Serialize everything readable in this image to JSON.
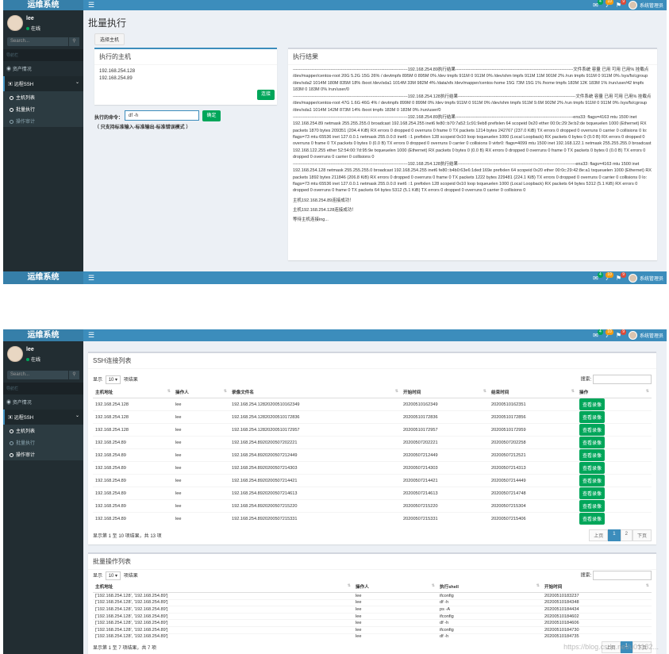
{
  "brand": "运维系统",
  "topbar": {
    "mail_badge": "4",
    "bell_badge": "10",
    "flag_badge": "9",
    "user": "系统管理员"
  },
  "user": {
    "name": "lee",
    "status": "在线"
  },
  "sidebar": {
    "search_placeholder": "Search...",
    "header": "导航栏",
    "asset": "资产情况",
    "ssh": "远程SSH",
    "sub": [
      "主机列表",
      "批量执行",
      "操作审计"
    ]
  },
  "page1": {
    "title": "批量执行",
    "select_btn": "选择主机",
    "hosts_title": "执行的主机",
    "hosts": [
      "192.168.254.128",
      "192.168.254.89"
    ],
    "connect_btn": "连接",
    "cmd_label": "执行的命令：",
    "cmd_value": "df -h",
    "confirm_btn": "确定",
    "hint": "（ 只支持标准输入-标准输出-标准错误模式 ）",
    "result_title": "执行结果",
    "result_blocks": [
      "-------------------------------------------------------------------------------192.168.254.89执行结果---------------------------------------------------------------------------------文件系统 容量 已用 可用 已用% 挂载点 /dev/mapper/centos-root 20G 5.2G 15G 26% / devtmpfs 895M 0 895M 0% /dev tmpfs 911M 0 911M 0% /dev/shm tmpfs 911M 11M 901M 2% /run tmpfs 911M 0 911M 0% /sys/fs/cgroup /dev/sda2 1014M 180M 835M 18% /boot /dev/sda1 1014M 33M 982M 4% /data/xfs /dev/mapper/centos-home 15G 73M 15G 1% /home tmpfs 183M 12K 183M 1% /run/user/42 tmpfs 183M 0 183M 0% /run/user/0",
      "-------------------------------------------------------------------------------192.168.254.128执行结果---------------------------------------------------------------------------------文件系统 容量 已用 可用 已用% 挂载点 /dev/mapper/centos-root 47G 1.6G 46G 4% / devtmpfs 899M 0 899M 0% /dev tmpfs 911M 0 911M 0% /dev/shm tmpfs 911M 9.6M 902M 2% /run tmpfs 911M 0 911M 0% /sys/fs/cgroup /dev/sda1 1014M 142M 873M 14% /boot tmpfs 183M 0 183M 0% /run/user/0",
      "-------------------------------------------------------------------------------192.168.254.89执行结果---------------------------------------------------------------------------------ens33: flags=4163 mtu 1500 inet 192.168.254.89 netmask 255.255.255.0 broadcast 192.168.254.255 inet6 fe80::b70:7a52:1c91:9eb8 prefixlen 64 scopeid 0x20 ether 00:0c:29:3e:b2:de txqueuelen 1000 (Ethernet) RX packets 1870 bytes 209351 (204.4 KiB) RX errors 0 dropped 0 overruns 0 frame 0 TX packets 1214 bytes 242767 (237.0 KiB) TX errors 0 dropped 0 overruns 0 carrier 0 collisions 0 lo: flags=73 mtu 65536 inet 127.0.0.1 netmask 255.0.0.0 inet6 ::1 prefixlen 128 scopeid 0x10 loop txqueuelen 1000 (Local Loopback) RX packets 0 bytes 0 (0.0 B) RX errors 0 dropped 0 overruns 0 frame 0 TX packets 0 bytes 0 (0.0 B) TX errors 0 dropped 0 overruns 0 carrier 0 collisions 0 virbr0: flags=4099 mtu 1500 inet 192.168.122.1 netmask 255.255.255.0 broadcast 192.168.122.255 ether 52:54:00:7d:95:9e txqueuelen 1000 (Ethernet) RX packets 0 bytes 0 (0.0 B) RX errors 0 dropped 0 overruns 0 frame 0 TX packets 0 bytes 0 (0.0 B) TX errors 0 dropped 0 overruns 0 carrier 0 collisions 0",
      "-------------------------------------------------------------------------------192.168.254.128执行结果---------------------------------------------------------------------------------ens33: flags=4163 mtu 1500 inet 192.168.254.128 netmask 255.255.255.0 broadcast 192.168.254.255 inet6 fe80::b4b0:63e6:1ded:169e prefixlen 64 scopeid 0x20 ether 00:0c:29:42:8e:a1 txqueuelen 1000 (Ethernet) RX packets 1892 bytes 211846 (206.8 KiB) RX errors 0 dropped 0 overruns 0 frame 0 TX packets 1222 bytes 229481 (224.1 KiB) TX errors 0 dropped 0 overruns 0 carrier 0 collisions 0 lo: flags=73 mtu 65536 inet 127.0.0.1 netmask 255.0.0.0 inet6 ::1 prefixlen 128 scopeid 0x10 loop txqueuelen 1000 (Local Loopback) RX packets 64 bytes 5312 (5.1 KiB) RX errors 0 dropped 0 overruns 0 frame 0 TX packets 64 bytes 5312 (5.1 KiB) TX errors 0 dropped 0 overruns 0 carrier 0 collisions 0"
    ],
    "result_msgs": [
      "主机192.168.254.89连接成功！",
      "主机192.168.254.128连接成功！",
      "等待主机连接ing..."
    ]
  },
  "ssh_table": {
    "title": "SSH连接列表",
    "show_label": "显示",
    "page_size": "10",
    "suffix_label": "项结果",
    "search_label": "搜索:",
    "columns": [
      "主机地址",
      "操作人",
      "录像文件名",
      "开始时间",
      "结束时间",
      "操作"
    ],
    "rows": [
      [
        "192.168.254.128",
        "lee",
        "192.168.254.12820200510162349",
        "20200510162349",
        "20200510162351"
      ],
      [
        "192.168.254.128",
        "lee",
        "192.168.254.12820200510172836",
        "20200510172836",
        "20200510172856"
      ],
      [
        "192.168.254.128",
        "lee",
        "192.168.254.12820200510172957",
        "20200510172957",
        "20200510172959"
      ],
      [
        "192.168.254.89",
        "lee",
        "192.168.254.8920200507202221",
        "20200507202221",
        "20200507202258"
      ],
      [
        "192.168.254.89",
        "lee",
        "192.168.254.8920200507212449",
        "20200507212449",
        "20200507212521"
      ],
      [
        "192.168.254.89",
        "lee",
        "192.168.254.8920200507214303",
        "20200507214303",
        "20200507214313"
      ],
      [
        "192.168.254.89",
        "lee",
        "192.168.254.8920200507214421",
        "20200507214421",
        "20200507214449"
      ],
      [
        "192.168.254.89",
        "lee",
        "192.168.254.8920200507214613",
        "20200507214613",
        "20200507214748"
      ],
      [
        "192.168.254.89",
        "lee",
        "192.168.254.8920200507215220",
        "20200507215220",
        "20200507215304"
      ],
      [
        "192.168.254.89",
        "lee",
        "192.168.254.8920200507215331",
        "20200507215331",
        "20200507215406"
      ]
    ],
    "action_btn": "查看录像",
    "info": "显示第 1 至 10 项结果，共 13 项",
    "prev": "上页",
    "pages": [
      "1",
      "2"
    ],
    "next": "下页"
  },
  "batch_table": {
    "title": "批量操作列表",
    "show_label": "显示",
    "page_size": "10",
    "suffix_label": "项结果",
    "search_label": "搜索:",
    "columns": [
      "主机地址",
      "操作人",
      "执行shell",
      "开始时间"
    ],
    "rows": [
      [
        "['192.168.254.128', '192.168.254.89']",
        "lee",
        "ifconfig",
        "20200510183237"
      ],
      [
        "['192.168.254.128', '192.168.254.89']",
        "lee",
        "df -h",
        "20200510184348"
      ],
      [
        "['192.168.254.128', '192.168.254.89']",
        "lee",
        "ps -A",
        "20200510184434"
      ],
      [
        "['192.168.254.128', '192.168.254.89']",
        "lee",
        "ifconfig",
        "20200510184602"
      ],
      [
        "['192.168.254.128', '192.168.254.89']",
        "lee",
        "df -h",
        "20200510184606"
      ],
      [
        "['192.168.254.128', '192.168.254.89']",
        "lee",
        "ifconfig",
        "20200510184730"
      ],
      [
        "['192.168.254.128', '192.168.254.89']",
        "lee",
        "df -h",
        "20200510184735"
      ]
    ],
    "info": "显示第 1 至 7 项结果，共 7 项",
    "prev": "上页",
    "pages": [
      "1"
    ],
    "next": "下页"
  },
  "watermark": "https://blog.csdn.net/u01132..."
}
